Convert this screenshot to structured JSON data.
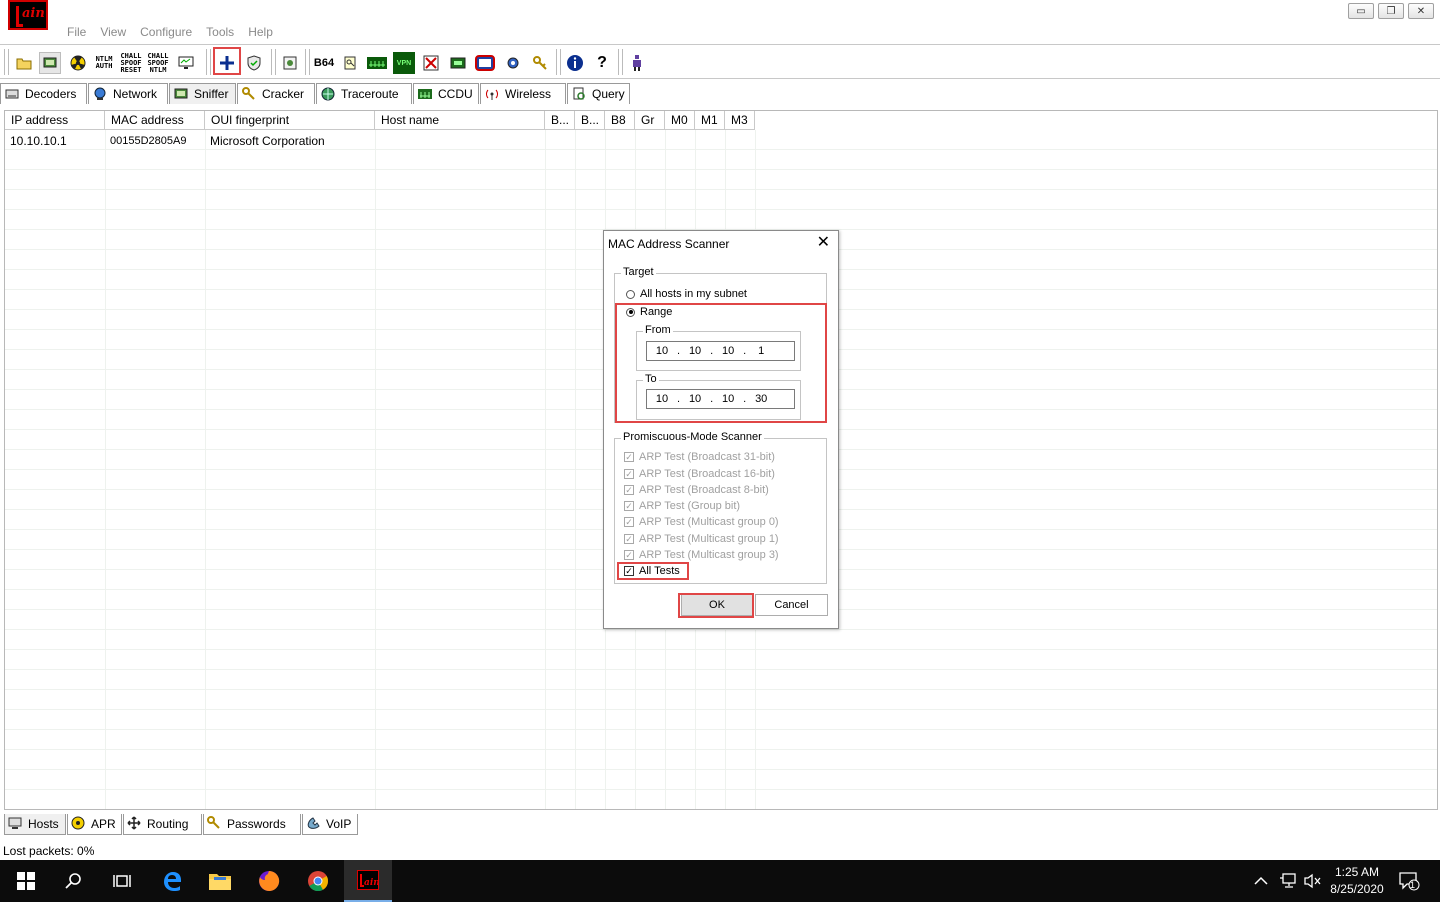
{
  "window": {
    "app_logo_text": "ain",
    "menu": [
      "File",
      "View",
      "Configure",
      "Tools",
      "Help"
    ],
    "controls": {
      "minimize": "▭",
      "restore": "❐",
      "close": "✕"
    }
  },
  "toolbar": {
    "text_buttons": {
      "ntlm_auth": "NTLM AUTH",
      "chall_spoof_reset": "CHALL SPOOF RESET",
      "chall_spoof_ntlm": "CHALL SPOOF NTLM",
      "b64": "B64",
      "vpn": "VPN"
    },
    "add_button_icon": "plus-icon"
  },
  "tabs": [
    {
      "label": "Decoders",
      "icon": "decoders-icon"
    },
    {
      "label": "Network",
      "icon": "network-icon"
    },
    {
      "label": "Sniffer",
      "icon": "sniffer-icon",
      "active": true
    },
    {
      "label": "Cracker",
      "icon": "cracker-icon"
    },
    {
      "label": "Traceroute",
      "icon": "traceroute-icon"
    },
    {
      "label": "CCDU",
      "icon": "ccdu-icon"
    },
    {
      "label": "Wireless",
      "icon": "wireless-icon"
    },
    {
      "label": "Query",
      "icon": "query-icon"
    }
  ],
  "table": {
    "columns": [
      "IP address",
      "MAC address",
      "OUI fingerprint",
      "Host name",
      "B...",
      "B...",
      "B8",
      "Gr",
      "M0",
      "M1",
      "M3"
    ],
    "rows": [
      [
        "10.10.10.1",
        "00155D2805A9",
        "Microsoft Corporation",
        "",
        "",
        "",
        "",
        "",
        "",
        "",
        ""
      ]
    ]
  },
  "dialog": {
    "title": "MAC Address Scanner",
    "close_glyph": "✕",
    "target_label": "Target",
    "option_all_hosts": "All hosts in my subnet",
    "option_range": "Range",
    "range_selected": true,
    "from_label": "From",
    "from_ip": [
      "10",
      "10",
      "10",
      "1"
    ],
    "to_label": "To",
    "to_ip": [
      "10",
      "10",
      "10",
      "30"
    ],
    "promisc_label": "Promiscuous-Mode Scanner",
    "tests": [
      "ARP Test (Broadcast 31-bit)",
      "ARP Test (Broadcast 16-bit)",
      "ARP Test (Broadcast 8-bit)",
      "ARP Test (Group bit)",
      "ARP Test (Multicast group 0)",
      "ARP Test (Multicast group 1)",
      "ARP Test (Multicast group 3)"
    ],
    "all_tests_label": "All Tests",
    "ok_label": "OK",
    "cancel_label": "Cancel"
  },
  "bottom_tabs": [
    {
      "label": "Hosts",
      "icon": "hosts-icon",
      "active": true
    },
    {
      "label": "APR",
      "icon": "apr-icon"
    },
    {
      "label": "Routing",
      "icon": "routing-icon"
    },
    {
      "label": "Passwords",
      "icon": "passwords-icon"
    },
    {
      "label": "VoIP",
      "icon": "voip-icon"
    }
  ],
  "status": {
    "text": "Lost packets:  0%"
  },
  "taskbar": {
    "time": "1:25 AM",
    "date": "8/25/2020",
    "notification_count": "1"
  },
  "colors": {
    "highlight": "#e04646",
    "taskbar": "#0c0c0c",
    "accent": "#78aee8"
  }
}
